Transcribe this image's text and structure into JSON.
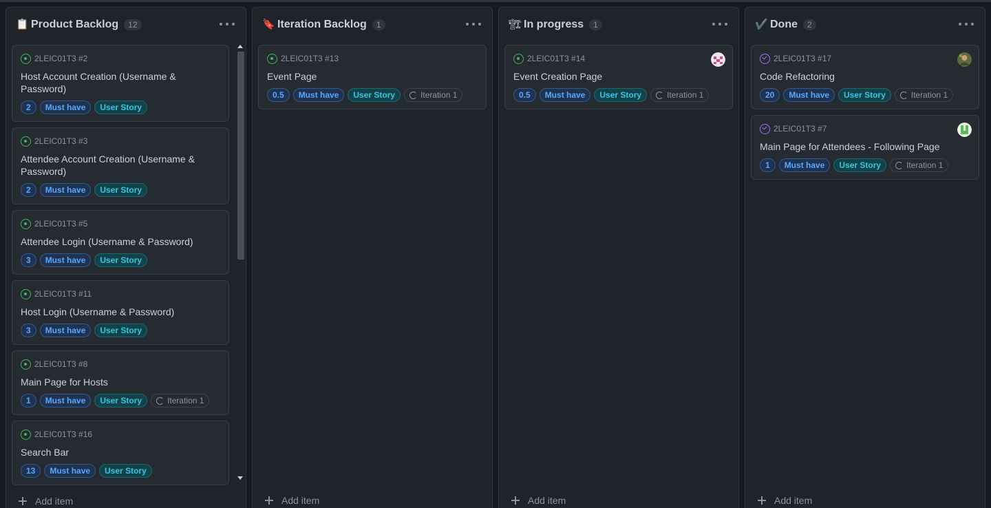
{
  "columns": [
    {
      "emoji": "📋",
      "title": "Product Backlog",
      "count": "12",
      "add_label": "Add item",
      "cards": [
        {
          "ref": "2LEIC01T3 #2",
          "title": "Host Account Creation (Username & Password)",
          "points": "2",
          "priority": "Must have",
          "type": "User Story"
        },
        {
          "ref": "2LEIC01T3 #3",
          "title": "Attendee Account Creation (Username & Password)",
          "points": "2",
          "priority": "Must have",
          "type": "User Story"
        },
        {
          "ref": "2LEIC01T3 #5",
          "title": "Attendee Login (Username & Password)",
          "points": "3",
          "priority": "Must have",
          "type": "User Story"
        },
        {
          "ref": "2LEIC01T3 #11",
          "title": "Host Login (Username & Password)",
          "points": "3",
          "priority": "Must have",
          "type": "User Story"
        },
        {
          "ref": "2LEIC01T3 #8",
          "title": "Main Page for Hosts",
          "points": "1",
          "priority": "Must have",
          "type": "User Story",
          "iteration": "Iteration 1"
        },
        {
          "ref": "2LEIC01T3 #16",
          "title": "Search Bar",
          "points": "13",
          "priority": "Must have",
          "type": "User Story"
        }
      ]
    },
    {
      "emoji": "🔖",
      "title": "Iteration Backlog",
      "count": "1",
      "add_label": "Add item",
      "cards": [
        {
          "ref": "2LEIC01T3 #13",
          "title": "Event Page",
          "points": "0.5",
          "priority": "Must have",
          "type": "User Story",
          "iteration": "Iteration 1"
        }
      ]
    },
    {
      "emoji": "🏗",
      "title": "In progress",
      "count": "1",
      "add_label": "Add item",
      "cards": [
        {
          "ref": "2LEIC01T3 #14",
          "title": "Event Creation Page",
          "points": "0.5",
          "priority": "Must have",
          "type": "User Story",
          "iteration": "Iteration 1",
          "avatar": "pink-avatar"
        }
      ]
    },
    {
      "emoji": "✔️",
      "title": "Done",
      "count": "2",
      "add_label": "Add item",
      "cards": [
        {
          "ref": "2LEIC01T3 #17",
          "title": "Code Refactoring",
          "points": "20",
          "priority": "Must have",
          "type": "User Story",
          "iteration": "Iteration 1",
          "avatar": "photo-avatar",
          "done": true
        },
        {
          "ref": "2LEIC01T3 #7",
          "title": "Main Page for Attendees - Following Page",
          "points": "1",
          "priority": "Must have",
          "type": "User Story",
          "iteration": "Iteration 1",
          "avatar": "green-avatar",
          "done": true
        }
      ]
    }
  ],
  "colors": {
    "background": "#161b22",
    "column": "#1f232a",
    "card": "#262b32",
    "open_issue": "#3fb950",
    "closed_issue": "#a371f7",
    "label_blue": "#58a6ff",
    "label_teal": "#39c5e0"
  }
}
